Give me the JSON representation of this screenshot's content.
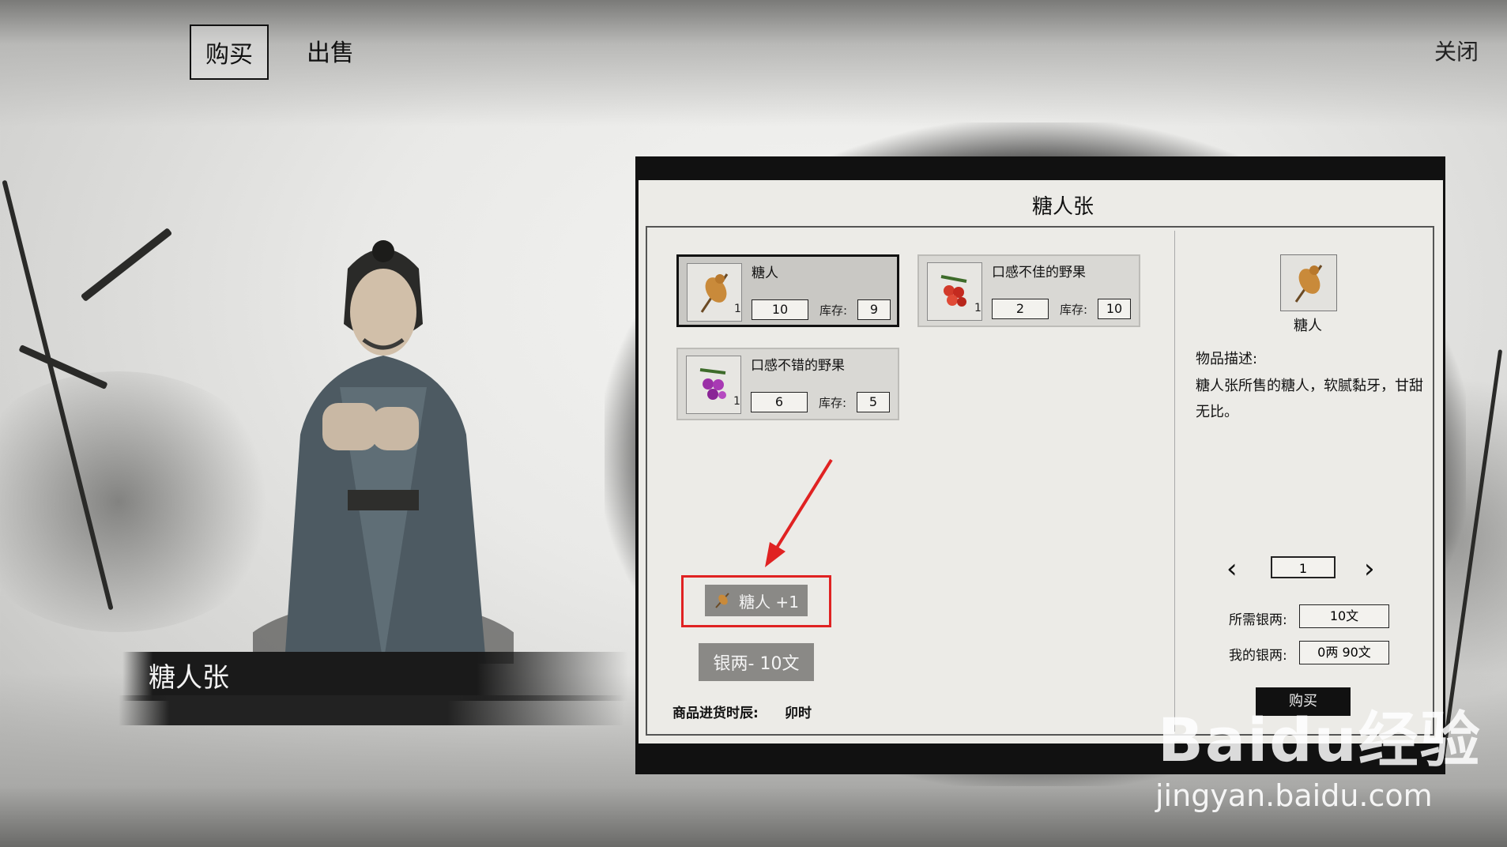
{
  "top_tabs": {
    "buy": "购买",
    "sell": "出售"
  },
  "close_label": "关闭",
  "npc": {
    "name": "糖人张"
  },
  "shop": {
    "title": "糖人张",
    "items": [
      {
        "name": "糖人",
        "icon": "sugar-figure-icon",
        "qty_mini": "1",
        "price": "10",
        "stock_label": "库存:",
        "stock": "9",
        "selected": true
      },
      {
        "name": "口感不佳的野果",
        "icon": "red-berries-icon",
        "qty_mini": "1",
        "price": "2",
        "stock_label": "库存:",
        "stock": "10",
        "selected": false
      },
      {
        "name": "口感不错的野果",
        "icon": "purple-berries-icon",
        "qty_mini": "1",
        "price": "6",
        "stock_label": "库存:",
        "stock": "5",
        "selected": false
      }
    ],
    "cart_item": "糖人 +1",
    "cost": "银两- 10文",
    "restock_label": "商品进货时辰:",
    "restock_value": "卯时"
  },
  "detail": {
    "name": "糖人",
    "desc_label": "物品描述:",
    "desc_text": "糖人张所售的糖人，软腻黏牙，甘甜无比。",
    "qty": "1",
    "need_label": "所需银两:",
    "need_value": "10文",
    "my_label": "我的银两:",
    "my_value": "0两 90文",
    "buy_label": "购买"
  },
  "watermark": {
    "logo": "Baidu经验",
    "url": "jingyan.baidu.com"
  },
  "colors": {
    "highlight": "#e02222",
    "panel": "#111111",
    "paper": "#ecebe7"
  }
}
